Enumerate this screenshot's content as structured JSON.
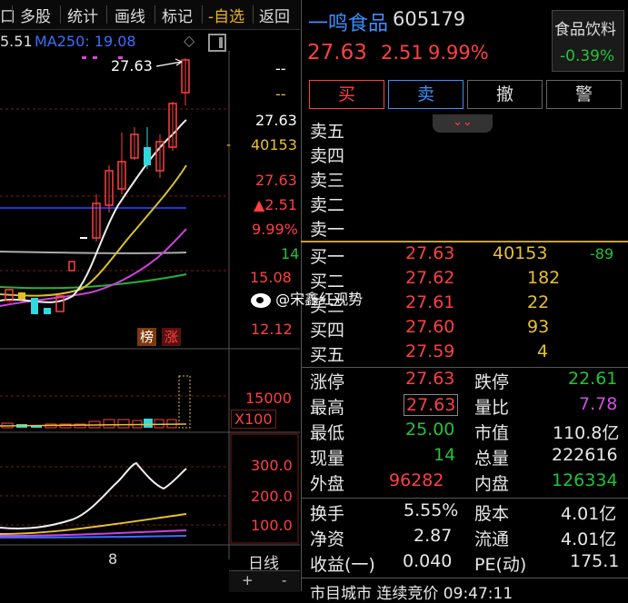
{
  "nav": {
    "partial": "口",
    "items": [
      "多股",
      "统计",
      "画线",
      "标记",
      "-自选",
      "返回"
    ]
  },
  "ma": {
    "partial": "5.51",
    "ma250": "MA250: 19.08"
  },
  "chart": {
    "price_labels": {
      "p1": "27.63",
      "dash1": "--",
      "dash2": "--",
      "last": "27.63",
      "vol": "40153",
      "price2": "27.63",
      "change": "▲2.51",
      "pct": "9.99%",
      "small": "14",
      "low1": "15.08",
      "low2": "12.12"
    },
    "badges": {
      "bang": "榜",
      "zhang": "涨"
    },
    "vol_axis": {
      "v1": "15000",
      "unit": "X100"
    },
    "ind_axis": {
      "a": "300.0",
      "b": "200.0",
      "c": "100.0"
    },
    "x_label": "8",
    "period": "日线",
    "plus": "+",
    "minus": "-"
  },
  "stock": {
    "name": "一鸣食品",
    "code": "605179",
    "price": "27.63",
    "change": "2.51",
    "pct": "9.99%",
    "sector_name": "食品饮料",
    "sector_pct": "-0.39%"
  },
  "actions": {
    "buy": "买",
    "sell": "卖",
    "cancel": "撤",
    "alert": "警"
  },
  "asks": [
    {
      "label": "卖五"
    },
    {
      "label": "卖四"
    },
    {
      "label": "卖三"
    },
    {
      "label": "卖二"
    },
    {
      "label": "卖一"
    }
  ],
  "bids": [
    {
      "label": "买一",
      "price": "27.63",
      "vol": "40153",
      "delta": "-89"
    },
    {
      "label": "买二",
      "price": "27.62",
      "vol": "182",
      "delta": ""
    },
    {
      "label": "买三",
      "price": "27.61",
      "vol": "22",
      "delta": ""
    },
    {
      "label": "买四",
      "price": "27.60",
      "vol": "93",
      "delta": ""
    },
    {
      "label": "买五",
      "price": "27.59",
      "vol": "4",
      "delta": ""
    }
  ],
  "watermark": "@宋鑫红观势",
  "stats": [
    {
      "k1": "涨停",
      "v1": "27.63",
      "k2": "跌停",
      "v2": "22.61"
    },
    {
      "k1": "最高",
      "v1": "27.63",
      "k2": "量比",
      "v2": "7.78"
    },
    {
      "k1": "最低",
      "v1": "25.00",
      "k2": "市值",
      "v2": "110.8亿"
    },
    {
      "k1": "现量",
      "v1": "14",
      "k2": "总量",
      "v2": "222616"
    },
    {
      "k1": "外盘",
      "v1": "96282",
      "k2": "内盘",
      "v2": "126334"
    }
  ],
  "fund": [
    {
      "k1": "换手",
      "v1": "5.55%",
      "k2": "股本",
      "v2": "4.01亿"
    },
    {
      "k1": "净资",
      "v1": "2.87",
      "k2": "流通",
      "v2": "4.01亿"
    },
    {
      "k1": "收益(一)",
      "v1": "0.040",
      "k2": "PE(动)",
      "v2": "175.1"
    }
  ],
  "bottom_partial": "市目城市 连续竞价 09:47:11",
  "colors": {
    "up": "#ff4040",
    "down": "#22c33a",
    "accent": "#e6c230"
  }
}
